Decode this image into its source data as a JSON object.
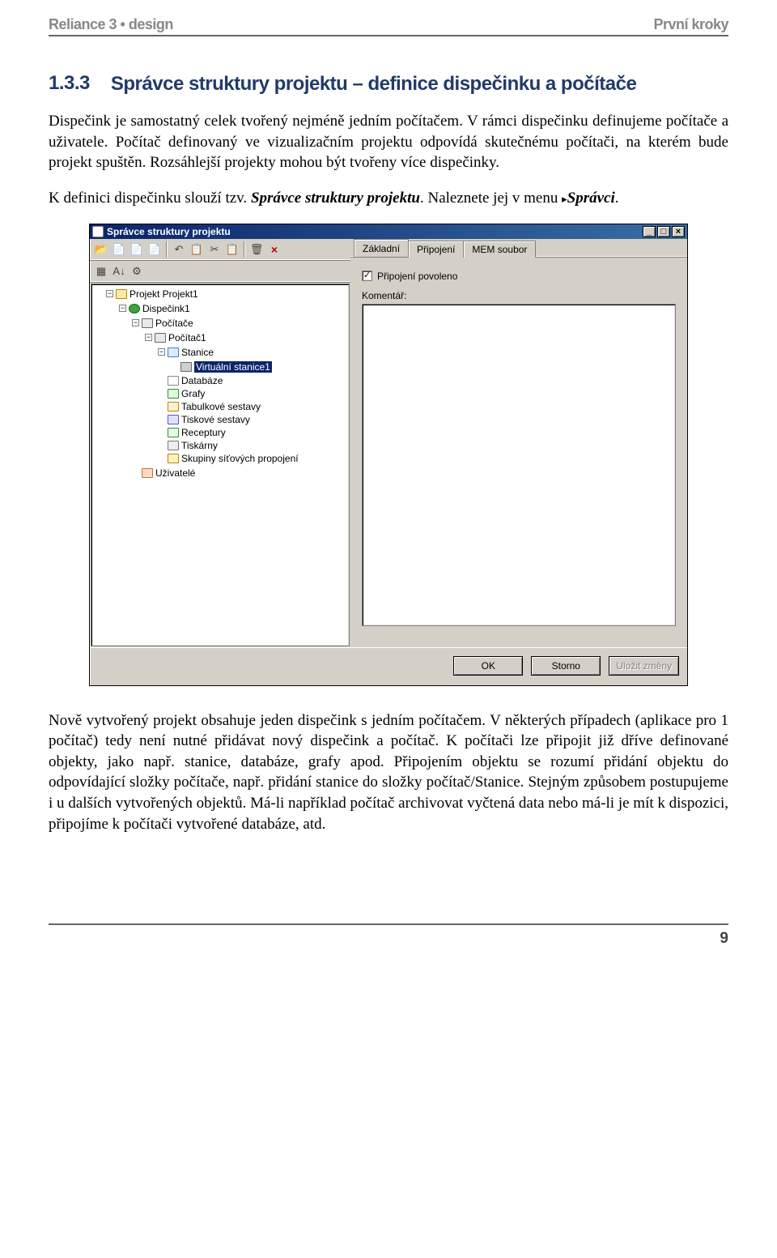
{
  "header": {
    "left": "Reliance 3 • design",
    "right": "První kroky"
  },
  "section": {
    "number": "1.3.3",
    "title": "Správce struktury projektu – definice dispečinku a počítače"
  },
  "para1_a": "Dispečink je samostatný celek tvořený nejméně jedním počítačem. V rámci dispečinku definujeme počítače a uživatele. Počítač definovaný ve vizualizačním projektu odpovídá skutečnému počítači, na kterém bude projekt spuštěn. Rozsáhlejší projekty mohou být tvořeny více dispečinky.",
  "para2_a": "K definici dispečinku slouží tzv. ",
  "para2_b": "Správce struktury projektu",
  "para2_c": ". Naleznete jej v menu ",
  "para2_d": "Správci",
  "para2_e": ".",
  "para3": "Nově vytvořený projekt obsahuje jeden dispečink s jedním počítačem. V některých případech (aplikace pro 1 počítač) tedy není nutné přidávat nový dispečink a počítač. K počítači lze připojit již dříve definované objekty, jako např. stanice, databáze, grafy apod. Připojením objektu se rozumí přidání objektu do odpovídající složky počítače, např. přidání stanice do složky počítač/Stanice. Stejným způsobem postupujeme i u dalších vytvořených objektů. Má-li například počítač archivovat vyčtená data nebo má-li je mít k dispozici, připojíme k počítači vytvořené databáze, atd.",
  "page_number": "9",
  "win": {
    "title": "Správce struktury projektu",
    "min": "_",
    "max": "□",
    "close": "×",
    "toolbar_icons": [
      "📂",
      "📄",
      "📄",
      "📄",
      "",
      "↶",
      "📋",
      "✂",
      "📋",
      "",
      "🗑",
      "×"
    ],
    "toolbar2_icons": [
      "▦",
      "A↓",
      "⚙"
    ],
    "tree": {
      "root": "Projekt Projekt1",
      "dispatch": "Dispečink1",
      "computers_folder": "Počítače",
      "computer": "Počítač1",
      "stations_folder": "Stanice",
      "station_selected": "Virtuální stanice1",
      "folders": [
        "Databáze",
        "Grafy",
        "Tabulkové sestavy",
        "Tiskové sestavy",
        "Receptury",
        "Tiskárny",
        "Skupiny síťových propojení"
      ],
      "users": "Uživatelé"
    },
    "tabs": [
      "Základní",
      "Připojení",
      "MEM soubor"
    ],
    "checkbox_label": "Připojení povoleno",
    "comment_label": "Komentář:",
    "buttons": {
      "ok": "OK",
      "cancel": "Storno",
      "save": "Uložit změny"
    }
  }
}
